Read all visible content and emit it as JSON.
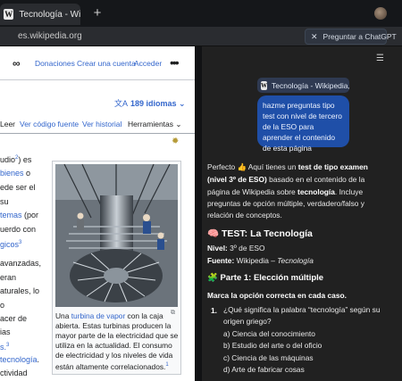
{
  "browser": {
    "tab_title": "Tecnología - Wikiped",
    "new_tab_symbol": "+",
    "url": "es.wikipedia.org",
    "ask_button": "Preguntar a ChatGPT",
    "ask_close": "✕"
  },
  "wiki": {
    "logo_glyph": "∞",
    "top_links": [
      "Donaciones",
      "Crear una cuenta",
      "Acceder"
    ],
    "menu": "•••",
    "languages": "189 idiomas",
    "tabs": [
      "Leer",
      "Ver código fuente",
      "Ver historial",
      "Herramientas"
    ],
    "text_fragments": [
      "udio",
      "2",
      ") es",
      "bienes",
      " o",
      "ede ser el",
      "su",
      "temas",
      " (por",
      "uerdo con",
      "gicos",
      "3",
      "avanzadas,",
      "eran",
      "aturales, lo",
      "o",
      "acer de",
      "ias",
      "s.",
      "3",
      "tecnología",
      ".",
      "ctividad"
    ],
    "caption": {
      "prefix": "Una ",
      "link": "turbina de vapor",
      "rest": " con la caja abierta. Estas turbinas producen la mayor parte de la electricidad que se utiliza en la actualidad. El consumo de electricidad y los niveles de vida están altamente correlacionados.",
      "ref": "1"
    }
  },
  "chat": {
    "context_chip": "Tecnología - Wikipedia, la e...",
    "user_message": "hazme preguntas tipo test con nivel de tercero de la ESO para aprender el contenido de esta página",
    "intro": {
      "line1_a": "Perfecto 👍 Aquí tienes un ",
      "line1_b": "test de tipo examen",
      "line2_a": "(nivel 3º de ESO)",
      "line2_b": " basado en el contenido de la",
      "line3_a": "página de Wikipedia sobre ",
      "line3_b": "tecnología",
      "line3_c": ". Incluye",
      "line4": "preguntas de opción múltiple, verdadero/falso y",
      "line5": "relación de conceptos."
    },
    "test_title": "🧠 TEST: La Tecnología",
    "nivel_label": "Nivel:",
    "nivel_value": " 3º de ESO",
    "fuente_label": "Fuente:",
    "fuente_value": " Wikipedia – ",
    "fuente_italic": "Tecnología",
    "part1_title": "🧩 Parte 1: Elección múltiple",
    "instruction": "Marca la opción correcta en cada caso.",
    "q1_number": "1.",
    "q1_line1": "¿Qué significa la palabra “tecnología” según su",
    "q1_line2": "origen griego?",
    "q1_options": [
      "a) Ciencia del conocimiento",
      "b) Estudio del arte o del oficio",
      "c) Ciencia de las máquinas",
      "d) Arte de fabricar cosas"
    ]
  },
  "colors": {
    "wiki_link": "#3366cc",
    "chat_bg": "#212121",
    "user_bubble": "#1f4fa8"
  }
}
